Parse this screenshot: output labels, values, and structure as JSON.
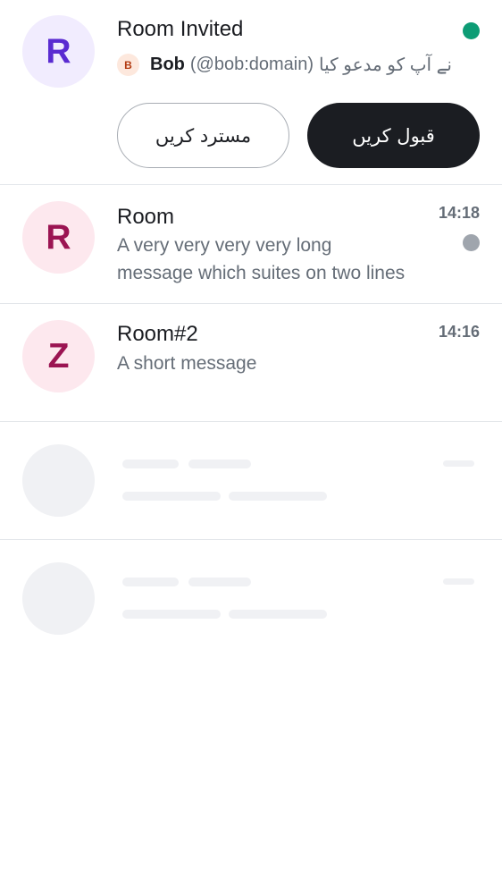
{
  "invite": {
    "avatar_letter": "R",
    "title": "Room Invited",
    "inviter_avatar_letter": "B",
    "inviter_name": "Bob",
    "inviter_handle": "(@bob:domain)",
    "invite_text": "نے آپ کو مدعو کیا",
    "decline_label": "مسترد کریں",
    "accept_label": "قبول کریں",
    "indicator_color": "#0d9c75"
  },
  "rooms": [
    {
      "avatar_letter": "R",
      "name": "Room",
      "time": "14:18",
      "message_line1": "A very very very very long",
      "message_line2": "message which suites on two lines",
      "unread_indicator_color": "#9fa5ad"
    },
    {
      "avatar_letter": "Z",
      "name": "Room#2",
      "time": "14:16",
      "message_line1": "A short message"
    }
  ],
  "colors": {
    "accent_dark": "#1b1d22",
    "secondary_text": "#656d77",
    "skeleton": "#f0f1f4",
    "divider": "#e3e6ea"
  }
}
